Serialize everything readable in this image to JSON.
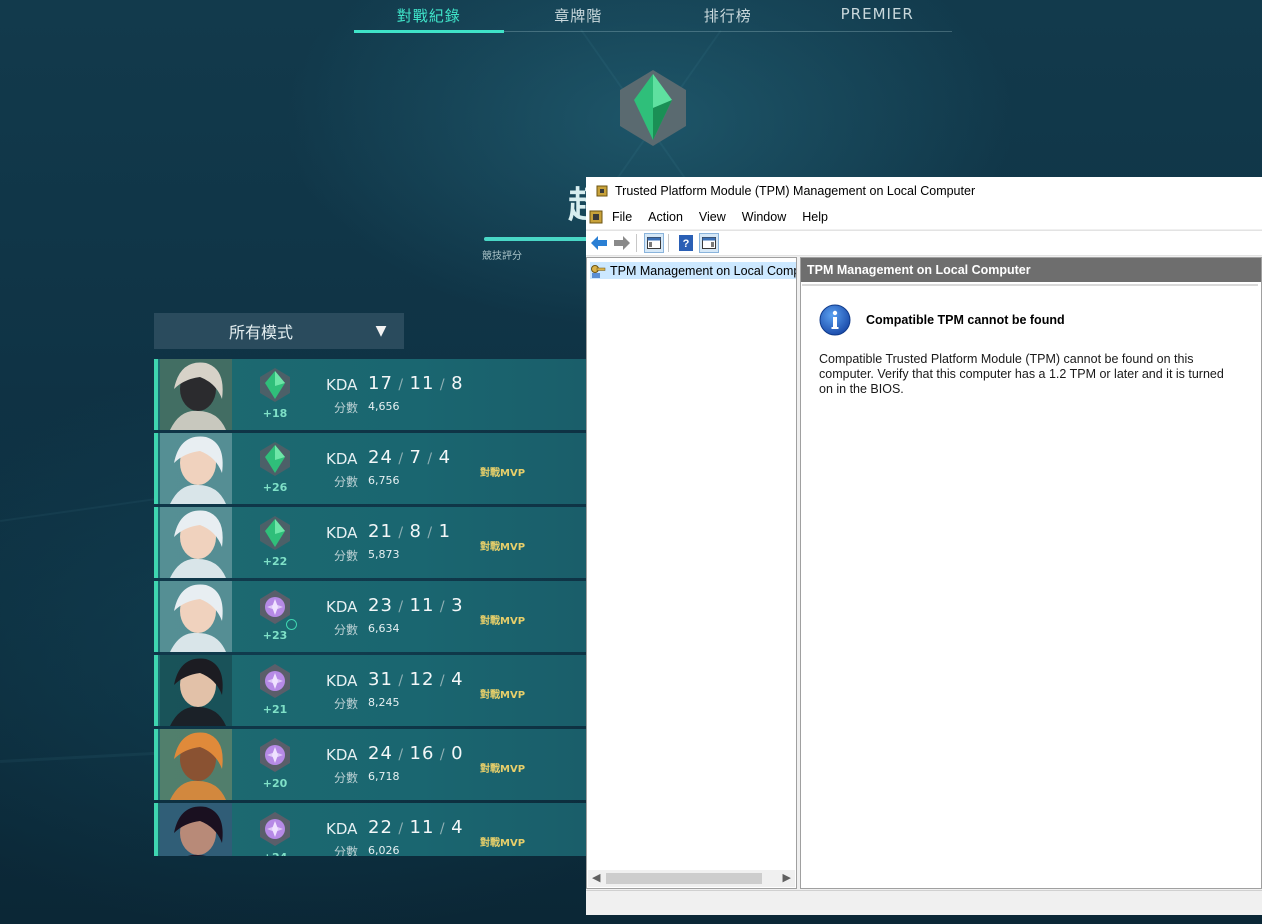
{
  "game": {
    "tabs": [
      {
        "label": "對戰紀錄",
        "active": true
      },
      {
        "label": "章牌階",
        "active": false
      },
      {
        "label": "排行榜",
        "active": false
      },
      {
        "label": "PREMIER",
        "active": false
      }
    ],
    "rank_title_fragment": "超",
    "rank_rating_label": "競技評分",
    "rank_rating_progress": 1.0,
    "mode_filter": {
      "selected": "所有模式"
    },
    "matches": [
      {
        "agent": "Cypher",
        "rank_badge": "emerald",
        "rr_change": "+18",
        "kda_label": "KDA",
        "kills": "17",
        "deaths": "11",
        "assists": "8",
        "score_label": "分數",
        "score": "4,656",
        "mvp": ""
      },
      {
        "agent": "Jett",
        "rank_badge": "emerald",
        "rr_change": "+26",
        "kda_label": "KDA",
        "kills": "24",
        "deaths": "7",
        "assists": "4",
        "score_label": "分數",
        "score": "6,756",
        "mvp": "對戰MVP"
      },
      {
        "agent": "Jett",
        "rank_badge": "emerald",
        "rr_change": "+22",
        "kda_label": "KDA",
        "kills": "21",
        "deaths": "8",
        "assists": "1",
        "score_label": "分數",
        "score": "5,873",
        "mvp": "對戰MVP"
      },
      {
        "agent": "Jett",
        "rank_badge": "diamond",
        "rr_change": "+23",
        "kda_label": "KDA",
        "kills": "23",
        "deaths": "11",
        "assists": "3",
        "score_label": "分數",
        "score": "6,634",
        "mvp": "對戰MVP",
        "rank_up": true
      },
      {
        "agent": "Viper",
        "rank_badge": "diamond",
        "rr_change": "+21",
        "kda_label": "KDA",
        "kills": "31",
        "deaths": "12",
        "assists": "4",
        "score_label": "分數",
        "score": "8,245",
        "mvp": "對戰MVP"
      },
      {
        "agent": "Raze",
        "rank_badge": "diamond",
        "rr_change": "+20",
        "kda_label": "KDA",
        "kills": "24",
        "deaths": "16",
        "assists": "0",
        "score_label": "分數",
        "score": "6,718",
        "mvp": "對戰MVP"
      },
      {
        "agent": "Reyna",
        "rank_badge": "diamond",
        "rr_change": "+24",
        "kda_label": "KDA",
        "kills": "22",
        "deaths": "11",
        "assists": "4",
        "score_label": "分數",
        "score": "6,026",
        "mvp": "對戰MVP"
      }
    ],
    "colors": {
      "accent": "#3fe3c8",
      "row": "#1d6a70",
      "mvp": "#e7cf6a",
      "emerald": "#2fbf7a",
      "diamond": "#b68ae6"
    }
  },
  "mmc": {
    "title": "Trusted Platform Module (TPM) Management on Local Computer",
    "menu": [
      "File",
      "Action",
      "View",
      "Window",
      "Help"
    ],
    "toolbar_icons": [
      "back-icon",
      "forward-icon",
      "show-hide-tree-icon",
      "help-icon",
      "show-hide-action-pane-icon"
    ],
    "tree": {
      "item": "TPM Management on Local Computer"
    },
    "detail": {
      "header": "TPM Management on Local Computer",
      "heading": "Compatible TPM cannot be found",
      "message": "Compatible Trusted Platform Module (TPM) cannot be found on this computer. Verify that this computer has a 1.2 TPM or later and it is turned on in the BIOS."
    }
  }
}
